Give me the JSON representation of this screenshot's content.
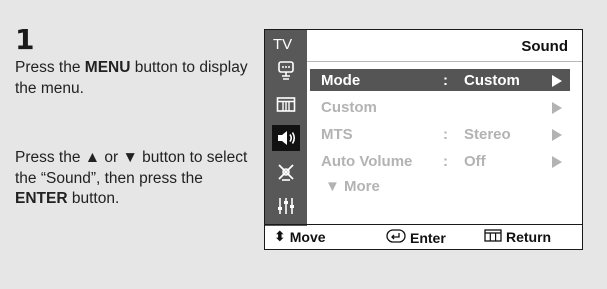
{
  "step": {
    "number": "1"
  },
  "instructions": {
    "p1_pre": "Press the ",
    "p1_bold": "MENU",
    "p1_post": " button to display the menu.",
    "p2_pre": "Press the ▲ or ▼ button to select the “Sound”, then press the ",
    "p2_bold": "ENTER",
    "p2_post": " button."
  },
  "osd": {
    "source_label": "TV",
    "title": "Sound",
    "sidebar_icons": [
      "picture-icon",
      "channel-icon",
      "sound-icon",
      "setup-icon",
      "input-icon"
    ],
    "active_icon": "sound-icon",
    "menu_items": [
      {
        "label": "Mode",
        "colon": ":",
        "value": "Custom",
        "arrow": "▶",
        "selected": true
      },
      {
        "label": "Custom",
        "colon": "",
        "value": "",
        "arrow": "▶",
        "selected": false
      },
      {
        "label": "MTS",
        "colon": ":",
        "value": "Stereo",
        "arrow": "▶",
        "selected": false
      },
      {
        "label": "Auto Volume",
        "colon": ":",
        "value": "Off",
        "arrow": "▶",
        "selected": false
      }
    ],
    "more_label": "▼ More",
    "footer": {
      "move_icon": "⬍",
      "move": "Move",
      "enter": "Enter",
      "return": "Return"
    },
    "colors": {
      "sidebar": "#585858",
      "selected_row": "#555555",
      "inactive_text": "#b3b3b3"
    }
  }
}
